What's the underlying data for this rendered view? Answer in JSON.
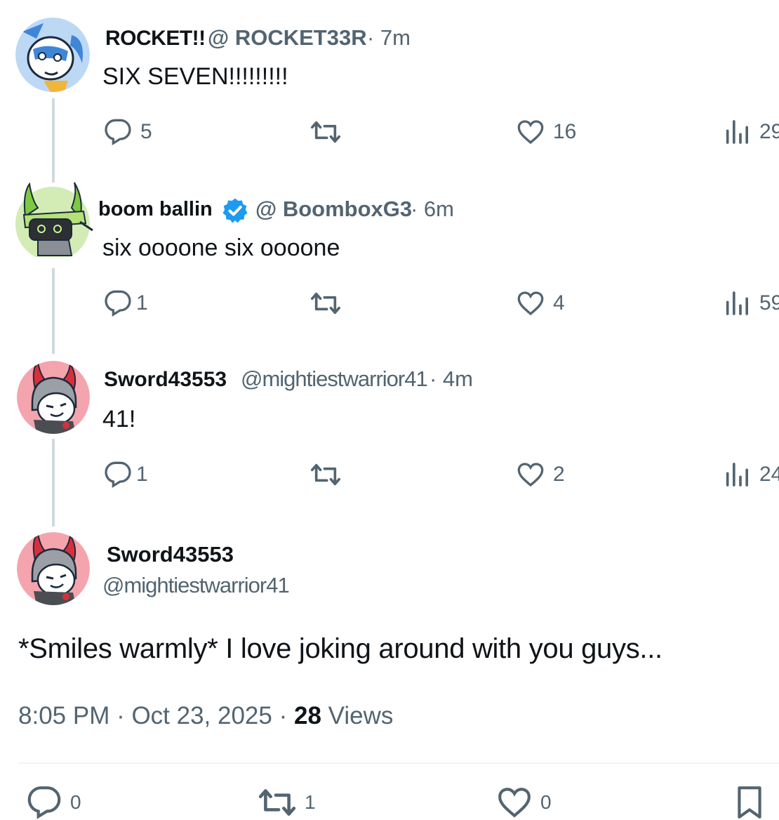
{
  "tweets": [
    {
      "name": "ROCKET!!",
      "handle": "@ ROCKET33R",
      "time": "· 7m",
      "text": "SIX SEVEN!!!!!!!!!",
      "replies": "5",
      "reposts": "",
      "likes": "16",
      "views": "29"
    },
    {
      "name": "boom ballin",
      "verified": true,
      "handle": "@ BoomboxG3",
      "time": "· 6m",
      "text": "six oooone six oooone",
      "replies": "1",
      "reposts": "",
      "likes": "4",
      "views": "59"
    },
    {
      "name": "Sword43553",
      "handle": "@mightiestwarrior41",
      "time": "· 4m",
      "text": "41!",
      "replies": "1",
      "reposts": "",
      "likes": "2",
      "views": "24"
    }
  ],
  "main": {
    "name": "Sword43553",
    "handle": "@mightiestwarrior41",
    "text": "*Smiles warmly* I love joking around with you guys...",
    "time": "8:05 PM · Oct 23, 2025 ·",
    "views_count": "28",
    "views_label": "Views",
    "replies": "0",
    "reposts": "1",
    "likes": "0"
  },
  "colors": {
    "text": "#0f1419",
    "secondary": "#536471",
    "thread_line": "#cfd9de",
    "verified": "#1d9bf0"
  },
  "icons": [
    "reply-icon",
    "repost-icon",
    "like-icon",
    "views-icon",
    "bookmark-icon",
    "verified-badge-icon"
  ]
}
